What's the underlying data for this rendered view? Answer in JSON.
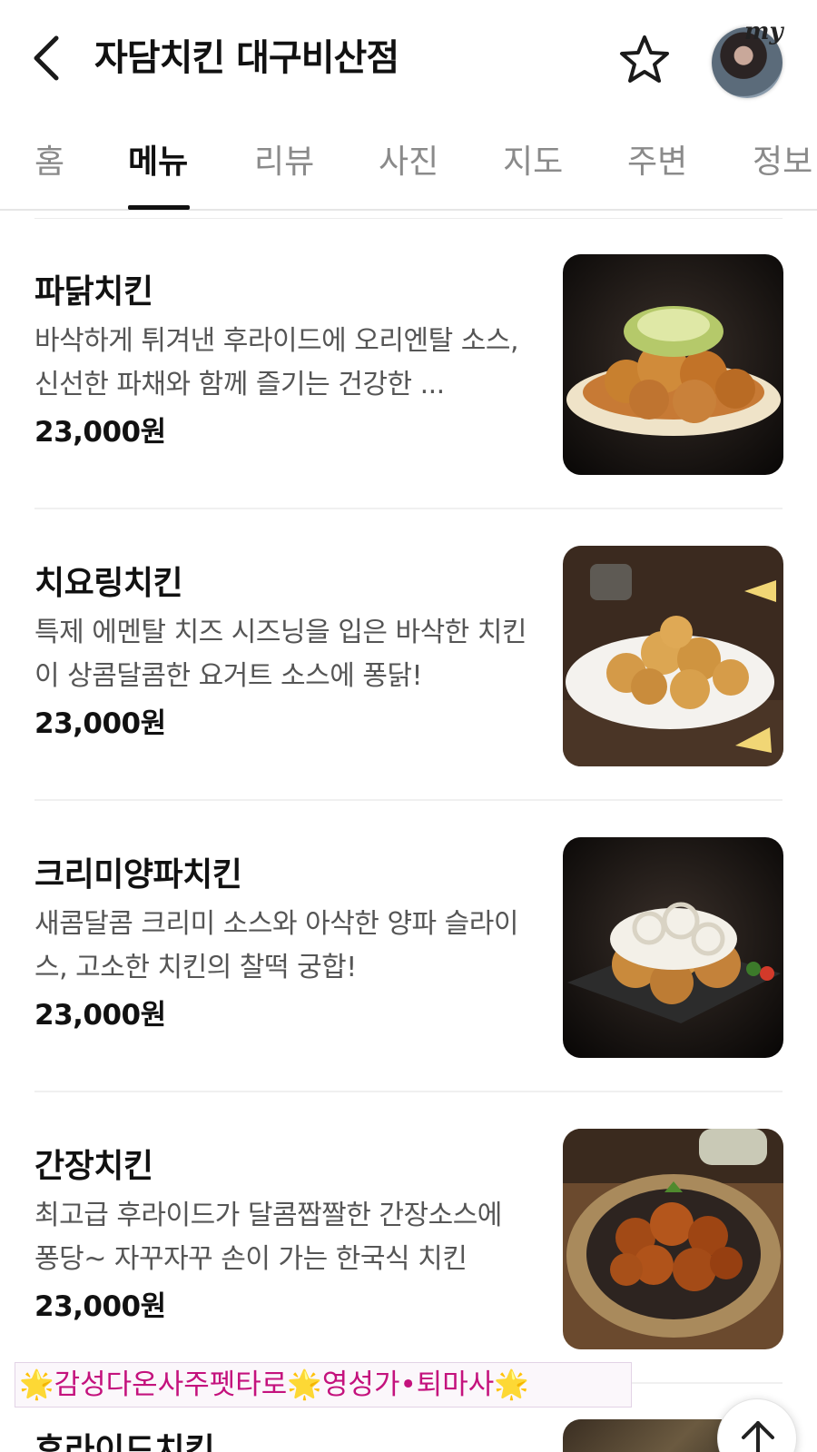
{
  "header": {
    "title": "자담치킨 대구비산점",
    "back_icon": "chevron-left-icon",
    "favorite_icon": "star-outline-icon",
    "avatar_badge": "my"
  },
  "tabs": [
    {
      "label": "홈",
      "active": false
    },
    {
      "label": "메뉴",
      "active": true
    },
    {
      "label": "리뷰",
      "active": false
    },
    {
      "label": "사진",
      "active": false
    },
    {
      "label": "지도",
      "active": false
    },
    {
      "label": "주변",
      "active": false
    },
    {
      "label": "정보",
      "active": false
    }
  ],
  "menu": [
    {
      "name": "파닭치킨",
      "description": "바삭하게 튀겨낸 후라이드에 오리엔탈 소스, 신선한 파채와 함께 즐기는 건강한 ...",
      "price": "23,000원"
    },
    {
      "name": "치요링치킨",
      "description": "특제 에멘탈 치즈 시즈닝을 입은 바삭한 치킨이 상콤달콤한 요거트 소스에 퐁닭!",
      "price": "23,000원"
    },
    {
      "name": "크리미양파치킨",
      "description": "새콤달콤 크리미 소스와 아삭한 양파 슬라이스, 고소한 치킨의 찰떡 궁합!",
      "price": "23,000원"
    },
    {
      "name": "간장치킨",
      "description": "최고급 후라이드가 달콤짭짤한 간장소스에 퐁당~ 자꾸자꾸 손이 가는 한국식 치킨",
      "price": "23,000원"
    }
  ],
  "next_item_partial": "후라이드치킨",
  "promo": {
    "star": "🌟",
    "part1": "감성다온사주펫타로",
    "part2": "영성가•퇴마사"
  },
  "scroll_top_icon": "arrow-up-icon",
  "colors": {
    "text_primary": "#111111",
    "text_secondary": "#555555",
    "tab_inactive": "#8a8a8a",
    "promo_text": "#c4127d"
  }
}
